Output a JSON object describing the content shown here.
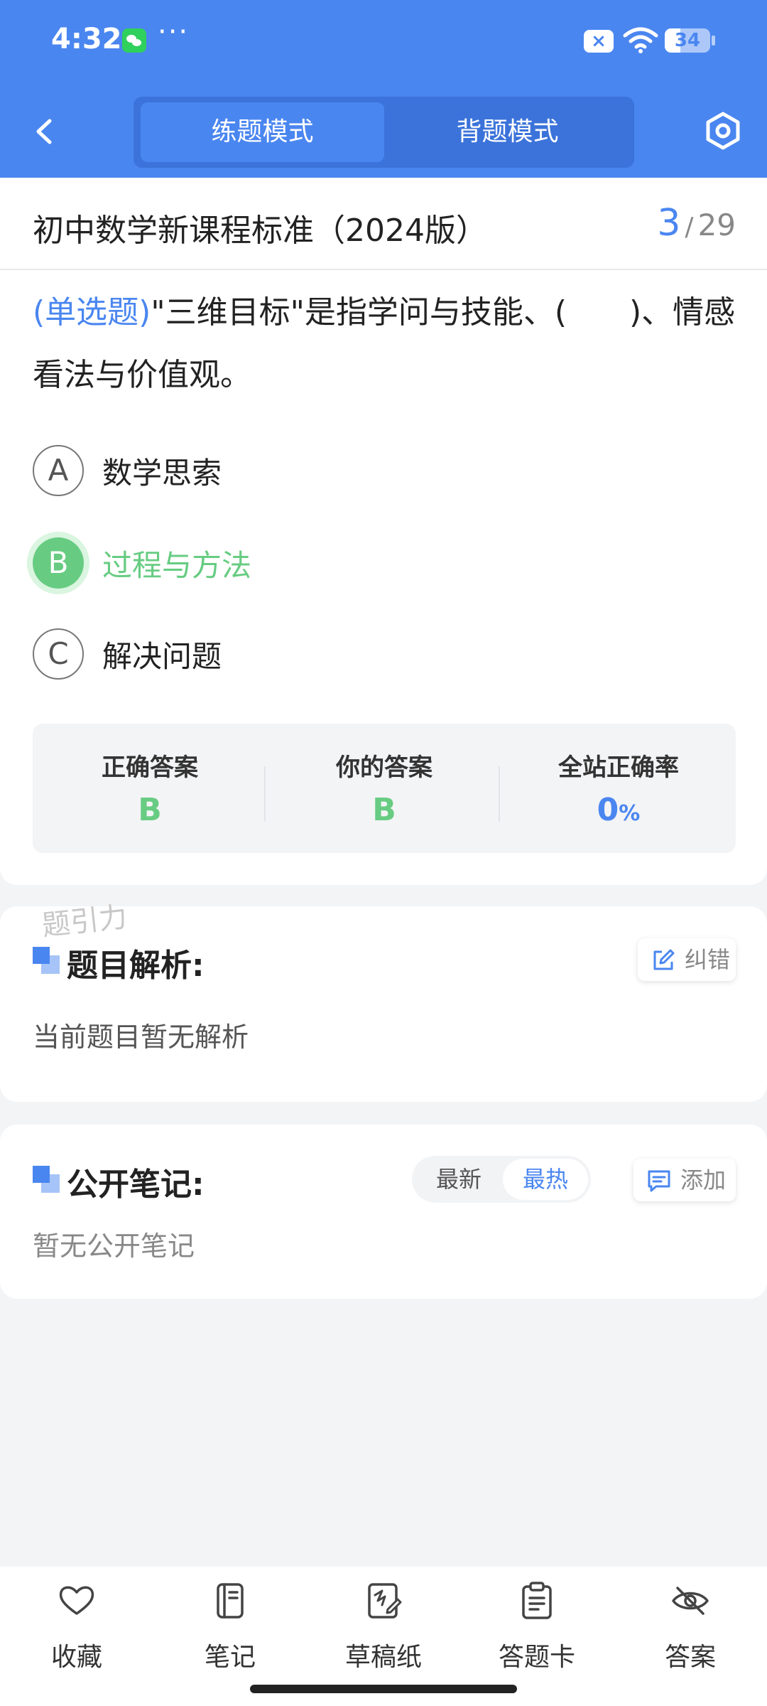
{
  "status_bar": {
    "time": "4:32",
    "more": "···",
    "notification_badge": "×",
    "battery": "34",
    "battery_level": 0.34
  },
  "header": {
    "modes": [
      "练题模式",
      "背题模式"
    ],
    "active_mode": 0
  },
  "question": {
    "subject": "初中数学新课程标准（2024版）",
    "current": "3",
    "separator": "/",
    "total": "29",
    "type": "(单选题)",
    "text": "\"三维目标\"是指学问与技能、(　　)、情感看法与价值观。",
    "options": [
      {
        "letter": "A",
        "text": "数学思索",
        "selected": false
      },
      {
        "letter": "B",
        "text": "过程与方法",
        "selected": true
      },
      {
        "letter": "C",
        "text": "解决问题",
        "selected": false
      }
    ]
  },
  "result": {
    "correct_label": "正确答案",
    "correct_value": "B",
    "yours_label": "你的答案",
    "yours_value": "B",
    "rate_label": "全站正确率",
    "rate_value": "0",
    "rate_unit": "%"
  },
  "watermark": "题引力",
  "analysis": {
    "title": "题目解析:",
    "correct_button": "纠错",
    "content": "当前题目暂无解析"
  },
  "notes": {
    "title": "公开笔记:",
    "sort_options": [
      "最新",
      "最热"
    ],
    "active_sort": 1,
    "add_button": "添加",
    "empty_text": "暂无公开笔记"
  },
  "bottom_nav": [
    {
      "label": "收藏",
      "icon": "heart-icon"
    },
    {
      "label": "笔记",
      "icon": "notebook-icon"
    },
    {
      "label": "草稿纸",
      "icon": "draft-paper-icon"
    },
    {
      "label": "答题卡",
      "icon": "answer-card-icon"
    },
    {
      "label": "答案",
      "icon": "eye-off-icon"
    }
  ],
  "colors": {
    "primary": "#4a86f0",
    "correct": "#67cc82",
    "background": "#f3f4f6"
  }
}
